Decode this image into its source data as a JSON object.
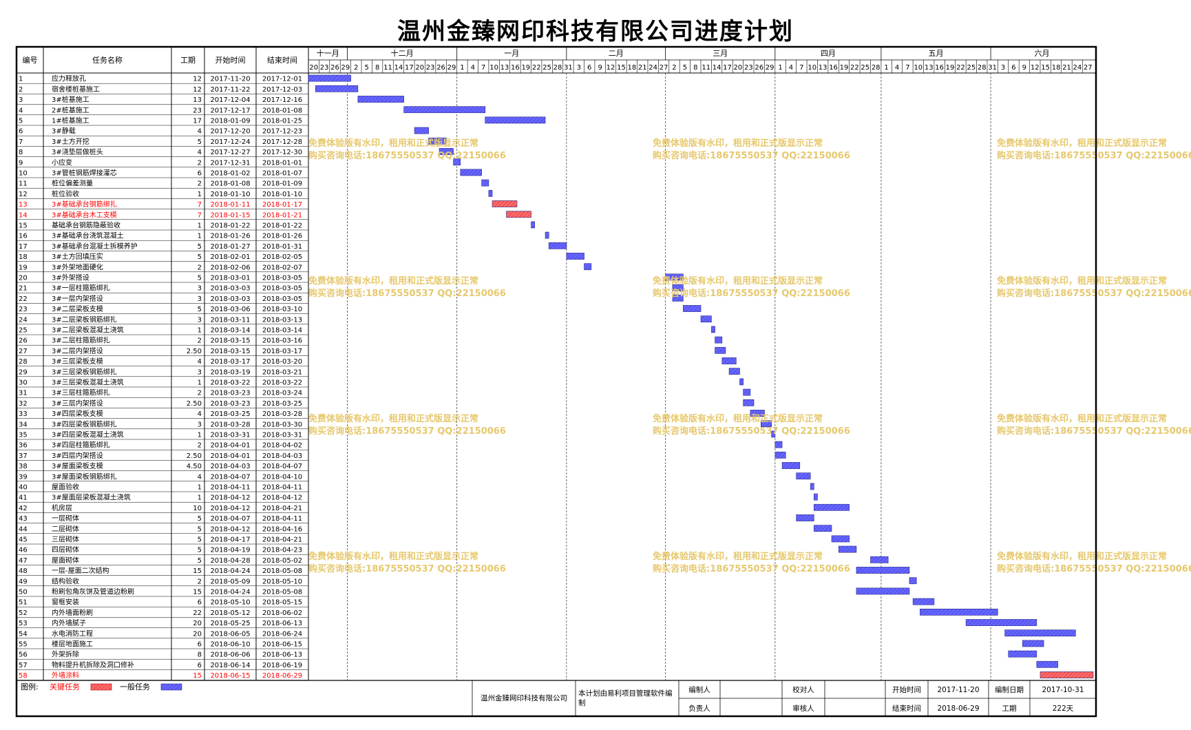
{
  "title": "温州金臻网印科技有限公司进度计划",
  "header": {
    "col_id": "编号",
    "col_name": "任务名称",
    "col_duration": "工期",
    "col_start": "开始时间",
    "col_end": "结束时间"
  },
  "timeline": {
    "months": [
      "十一月",
      "十二月",
      "一月",
      "二月",
      "三月",
      "四月",
      "五月",
      "六月"
    ],
    "day_ticks": [
      "20",
      "23",
      "26",
      "29",
      "2",
      "5",
      "8",
      "11",
      "14",
      "17",
      "20",
      "23",
      "26",
      "29",
      "1",
      "4",
      "7",
      "10",
      "13",
      "16",
      "19",
      "22",
      "25",
      "28",
      "31",
      "3",
      "6",
      "9",
      "12",
      "15",
      "18",
      "21",
      "24",
      "27",
      "2",
      "5",
      "8",
      "11",
      "14",
      "17",
      "20",
      "23",
      "26",
      "29",
      "1",
      "4",
      "7",
      "10",
      "13",
      "16",
      "19",
      "22",
      "25",
      "28",
      "1",
      "4",
      "7",
      "10",
      "13",
      "16",
      "19",
      "22",
      "25",
      "28",
      "31",
      "3",
      "6",
      "9",
      "12",
      "15",
      "18",
      "21",
      "24",
      "27"
    ]
  },
  "watermark": {
    "line1": "免费体验版有水印，租用和正式版显示正常",
    "line2": "购买咨询电话:18675550537 QQ:22150066"
  },
  "colors": {
    "critical": "#ff6060",
    "normal": "#6666ff",
    "critical_text": "#ff0000",
    "watermark": "#e6c86e"
  },
  "footer": {
    "legend_label": "图例:",
    "legend_critical": "关键任务",
    "legend_normal": "一般任务",
    "company": "温州金臻网印科技有限公司",
    "software_note": "本计划由易利项目管理软件编制",
    "editor_label": "编制人",
    "editor_value": "",
    "proofreader_label": "校对人",
    "proofreader_value": "",
    "start_label": "开始时间",
    "start_value": "2017-11-20",
    "compile_date_label": "编制日期",
    "compile_date_value": "2017-10-31",
    "manager_label": "负责人",
    "manager_value": "",
    "reviewer_label": "审核人",
    "reviewer_value": "",
    "end_label": "结束时间",
    "end_value": "2018-06-29",
    "duration_label": "工期",
    "duration_value": "222天"
  },
  "chart_data": {
    "type": "gantt",
    "x_range": [
      "2017-11-20",
      "2018-06-30"
    ],
    "tasks": [
      {
        "id": "1",
        "name": "应力释放孔",
        "duration": "12",
        "start": "2017-11-20",
        "end": "2017-12-01",
        "critical": false
      },
      {
        "id": "2",
        "name": "宿舍楼桩基施工",
        "duration": "12",
        "start": "2017-11-22",
        "end": "2017-12-03",
        "critical": false
      },
      {
        "id": "3",
        "name": "3#桩基施工",
        "duration": "13",
        "start": "2017-12-04",
        "end": "2017-12-16",
        "critical": false
      },
      {
        "id": "4",
        "name": "2#桩基施工",
        "duration": "23",
        "start": "2017-12-17",
        "end": "2018-01-08",
        "critical": false
      },
      {
        "id": "5",
        "name": "1#桩基施工",
        "duration": "17",
        "start": "2018-01-09",
        "end": "2018-01-25",
        "critical": false
      },
      {
        "id": "6",
        "name": "3#静载",
        "duration": "4",
        "start": "2017-12-20",
        "end": "2017-12-23",
        "critical": false
      },
      {
        "id": "7",
        "name": "3#土方开挖",
        "duration": "5",
        "start": "2017-12-24",
        "end": "2017-12-28",
        "critical": false
      },
      {
        "id": "8",
        "name": "3#浇垫层做桩头",
        "duration": "4",
        "start": "2017-12-27",
        "end": "2017-12-30",
        "critical": false
      },
      {
        "id": "9",
        "name": "小应变",
        "duration": "2",
        "start": "2017-12-31",
        "end": "2018-01-01",
        "critical": false
      },
      {
        "id": "10",
        "name": "3#管桩钢筋焊接灌芯",
        "duration": "6",
        "start": "2018-01-02",
        "end": "2018-01-07",
        "critical": false
      },
      {
        "id": "11",
        "name": "桩位偏差测量",
        "duration": "2",
        "start": "2018-01-08",
        "end": "2018-01-09",
        "critical": false
      },
      {
        "id": "12",
        "name": "桩位验收",
        "duration": "1",
        "start": "2018-01-10",
        "end": "2018-01-10",
        "critical": false
      },
      {
        "id": "13",
        "name": "3#基础承台钢筋绑扎",
        "duration": "7",
        "start": "2018-01-11",
        "end": "2018-01-17",
        "critical": true
      },
      {
        "id": "14",
        "name": "3#基础承台木工支模",
        "duration": "7",
        "start": "2018-01-15",
        "end": "2018-01-21",
        "critical": true
      },
      {
        "id": "15",
        "name": "基础承台钢筋隐蔽验收",
        "duration": "1",
        "start": "2018-01-22",
        "end": "2018-01-22",
        "critical": false
      },
      {
        "id": "16",
        "name": "3#基础承台浇筑混凝土",
        "duration": "1",
        "start": "2018-01-26",
        "end": "2018-01-26",
        "critical": false
      },
      {
        "id": "17",
        "name": "3#基础承台混凝土拆模养护",
        "duration": "5",
        "start": "2018-01-27",
        "end": "2018-01-31",
        "critical": false
      },
      {
        "id": "18",
        "name": "3#土方回填压实",
        "duration": "5",
        "start": "2018-02-01",
        "end": "2018-02-05",
        "critical": false
      },
      {
        "id": "19",
        "name": "3#外架地面硬化",
        "duration": "2",
        "start": "2018-02-06",
        "end": "2018-02-07",
        "critical": false
      },
      {
        "id": "20",
        "name": "3#外架搭设",
        "duration": "5",
        "start": "2018-03-01",
        "end": "2018-03-05",
        "critical": false
      },
      {
        "id": "21",
        "name": "3#一层柱箍筋绑扎",
        "duration": "3",
        "start": "2018-03-03",
        "end": "2018-03-05",
        "critical": false
      },
      {
        "id": "22",
        "name": "3#一层内架搭设",
        "duration": "3",
        "start": "2018-03-03",
        "end": "2018-03-05",
        "critical": false
      },
      {
        "id": "23",
        "name": "3#二层梁板支模",
        "duration": "5",
        "start": "2018-03-06",
        "end": "2018-03-10",
        "critical": false
      },
      {
        "id": "24",
        "name": "3#二层梁板钢筋绑扎",
        "duration": "3",
        "start": "2018-03-11",
        "end": "2018-03-13",
        "critical": false
      },
      {
        "id": "25",
        "name": "3#二层梁板混凝土浇筑",
        "duration": "1",
        "start": "2018-03-14",
        "end": "2018-03-14",
        "critical": false
      },
      {
        "id": "26",
        "name": "3#二层柱箍筋绑扎",
        "duration": "2",
        "start": "2018-03-15",
        "end": "2018-03-16",
        "critical": false
      },
      {
        "id": "27",
        "name": "3#二层内架搭设",
        "duration": "2.50",
        "start": "2018-03-15",
        "end": "2018-03-17",
        "critical": false
      },
      {
        "id": "28",
        "name": "3#三层梁板支模",
        "duration": "4",
        "start": "2018-03-17",
        "end": "2018-03-20",
        "critical": false
      },
      {
        "id": "29",
        "name": "3#三层梁板钢筋绑扎",
        "duration": "3",
        "start": "2018-03-19",
        "end": "2018-03-21",
        "critical": false
      },
      {
        "id": "30",
        "name": "3#三层梁板混凝土浇筑",
        "duration": "1",
        "start": "2018-03-22",
        "end": "2018-03-22",
        "critical": false
      },
      {
        "id": "31",
        "name": "3#三层柱箍筋绑扎",
        "duration": "2",
        "start": "2018-03-23",
        "end": "2018-03-24",
        "critical": false
      },
      {
        "id": "32",
        "name": "3#三层内架搭设",
        "duration": "2.50",
        "start": "2018-03-23",
        "end": "2018-03-25",
        "critical": false
      },
      {
        "id": "33",
        "name": "3#四层梁板支模",
        "duration": "4",
        "start": "2018-03-25",
        "end": "2018-03-28",
        "critical": false
      },
      {
        "id": "34",
        "name": "3#四层梁板钢筋绑扎",
        "duration": "3",
        "start": "2018-03-28",
        "end": "2018-03-30",
        "critical": false
      },
      {
        "id": "35",
        "name": "3#四层梁板混凝土浇筑",
        "duration": "1",
        "start": "2018-03-31",
        "end": "2018-03-31",
        "critical": false
      },
      {
        "id": "36",
        "name": "3#四层柱箍筋绑扎",
        "duration": "2",
        "start": "2018-04-01",
        "end": "2018-04-02",
        "critical": false
      },
      {
        "id": "37",
        "name": "3#四层内架搭设",
        "duration": "2.50",
        "start": "2018-04-01",
        "end": "2018-04-03",
        "critical": false
      },
      {
        "id": "38",
        "name": "3#屋面梁板支模",
        "duration": "4.50",
        "start": "2018-04-03",
        "end": "2018-04-07",
        "critical": false
      },
      {
        "id": "39",
        "name": "3#屋面梁板钢筋绑扎",
        "duration": "4",
        "start": "2018-04-07",
        "end": "2018-04-10",
        "critical": false
      },
      {
        "id": "40",
        "name": "屋面验收",
        "duration": "1",
        "start": "2018-04-11",
        "end": "2018-04-11",
        "critical": false
      },
      {
        "id": "41",
        "name": "3#屋面层梁板混凝土浇筑",
        "duration": "1",
        "start": "2018-04-12",
        "end": "2018-04-12",
        "critical": false
      },
      {
        "id": "42",
        "name": "机房层",
        "duration": "10",
        "start": "2018-04-12",
        "end": "2018-04-21",
        "critical": false
      },
      {
        "id": "43",
        "name": "一层砌体",
        "duration": "5",
        "start": "2018-04-07",
        "end": "2018-04-11",
        "critical": false
      },
      {
        "id": "44",
        "name": "二层砌体",
        "duration": "5",
        "start": "2018-04-12",
        "end": "2018-04-16",
        "critical": false
      },
      {
        "id": "45",
        "name": "三层砌体",
        "duration": "5",
        "start": "2018-04-17",
        "end": "2018-04-21",
        "critical": false
      },
      {
        "id": "46",
        "name": "四层砌体",
        "duration": "5",
        "start": "2018-04-19",
        "end": "2018-04-23",
        "critical": false
      },
      {
        "id": "47",
        "name": "屋面砌体",
        "duration": "5",
        "start": "2018-04-28",
        "end": "2018-05-02",
        "critical": false
      },
      {
        "id": "48",
        "name": "一层-屋面二次结构",
        "duration": "15",
        "start": "2018-04-24",
        "end": "2018-05-08",
        "critical": false
      },
      {
        "id": "49",
        "name": "结构验收",
        "duration": "2",
        "start": "2018-05-09",
        "end": "2018-05-10",
        "critical": false
      },
      {
        "id": "50",
        "name": "粉刷包角灰饼及管道边粉刷",
        "duration": "15",
        "start": "2018-04-24",
        "end": "2018-05-08",
        "critical": false
      },
      {
        "id": "51",
        "name": "窗框安装",
        "duration": "6",
        "start": "2018-05-10",
        "end": "2018-05-15",
        "critical": false
      },
      {
        "id": "52",
        "name": "内外墙面粉刷",
        "duration": "22",
        "start": "2018-05-12",
        "end": "2018-06-02",
        "critical": false
      },
      {
        "id": "53",
        "name": "内外墙腻子",
        "duration": "20",
        "start": "2018-05-25",
        "end": "2018-06-13",
        "critical": false
      },
      {
        "id": "54",
        "name": "水电消防工程",
        "duration": "20",
        "start": "2018-06-05",
        "end": "2018-06-24",
        "critical": false
      },
      {
        "id": "55",
        "name": "楼层地面施工",
        "duration": "6",
        "start": "2018-06-10",
        "end": "2018-06-15",
        "critical": false
      },
      {
        "id": "56",
        "name": "外架拆除",
        "duration": "8",
        "start": "2018-06-06",
        "end": "2018-06-13",
        "critical": false
      },
      {
        "id": "57",
        "name": "物料提升机拆除及洞口修补",
        "duration": "6",
        "start": "2018-06-14",
        "end": "2018-06-19",
        "critical": false
      },
      {
        "id": "58",
        "name": "外墙涂料",
        "duration": "15",
        "start": "2018-06-15",
        "end": "2018-06-29",
        "critical": true
      }
    ]
  }
}
